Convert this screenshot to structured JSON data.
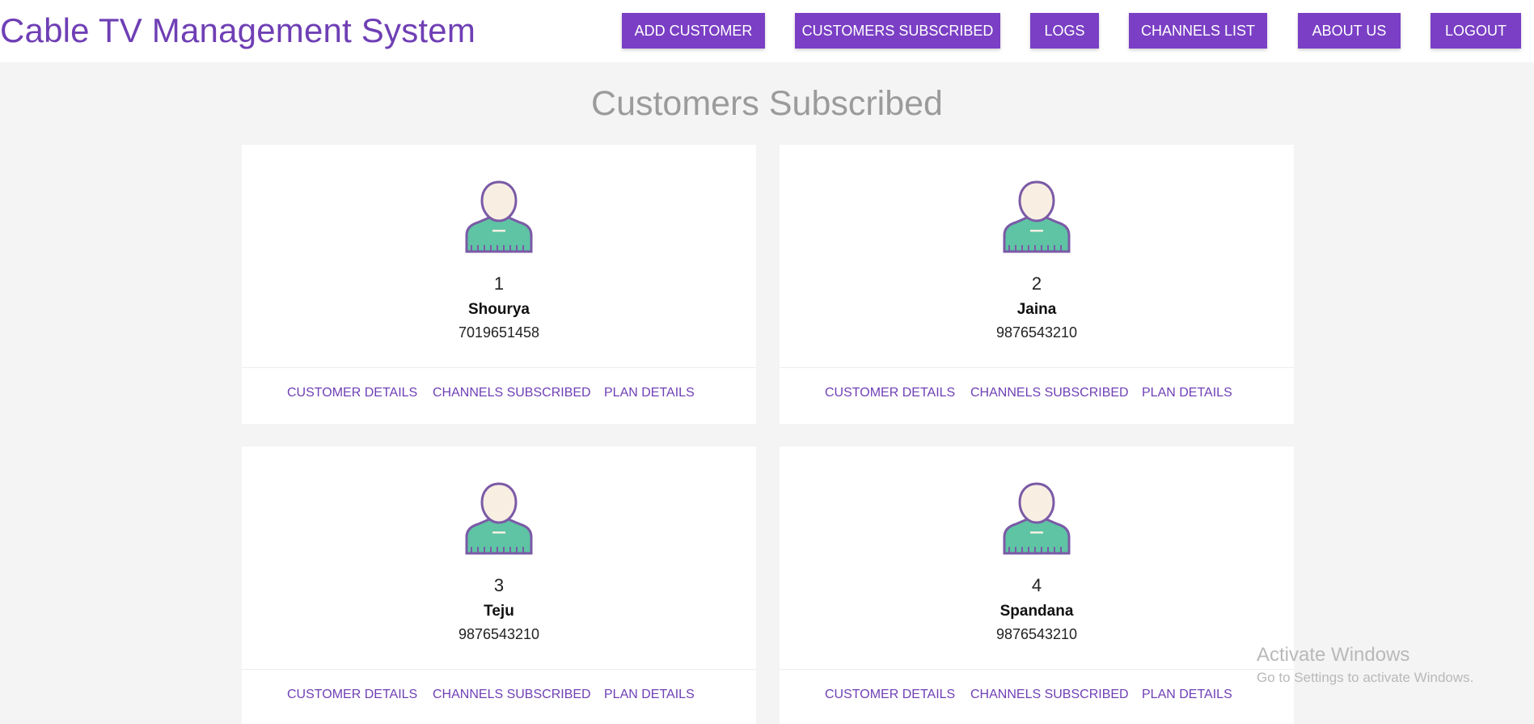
{
  "header": {
    "brand": "Cable TV Management System",
    "nav": [
      {
        "label": "ADD CUSTOMER"
      },
      {
        "label": "CUSTOMERS SUBSCRIBED"
      },
      {
        "label": "LOGS"
      },
      {
        "label": "CHANNELS LIST"
      },
      {
        "label": "ABOUT US"
      },
      {
        "label": "LOGOUT"
      }
    ]
  },
  "main": {
    "title": "Customers Subscribed",
    "customers": [
      {
        "id": "1",
        "name": "Shourya",
        "phone": "7019651458",
        "avatar_icon": "user-avatar-icon"
      },
      {
        "id": "2",
        "name": "Jaina",
        "phone": "9876543210",
        "avatar_icon": "user-avatar-icon"
      },
      {
        "id": "3",
        "name": "Teju",
        "phone": "9876543210",
        "avatar_icon": "user-avatar-icon"
      },
      {
        "id": "4",
        "name": "Spandana",
        "phone": "9876543210",
        "avatar_icon": "user-avatar-icon"
      }
    ],
    "card_actions": {
      "customer_details": "CUSTOMER DETAILS",
      "channels_subscribed": "CHANNELS SUBSCRIBED",
      "plan_details": "PLAN DETAILS"
    }
  },
  "watermark": {
    "title": "Activate Windows",
    "subtitle": "Go to Settings to activate Windows."
  },
  "colors": {
    "accent": "#7a3fc4",
    "brand_text": "#6f3fb5",
    "page_bg": "#f4f4f4",
    "avatar_shirt": "#5ec4a4",
    "avatar_skin": "#f8efe2",
    "avatar_outline": "#7b5aa6"
  }
}
